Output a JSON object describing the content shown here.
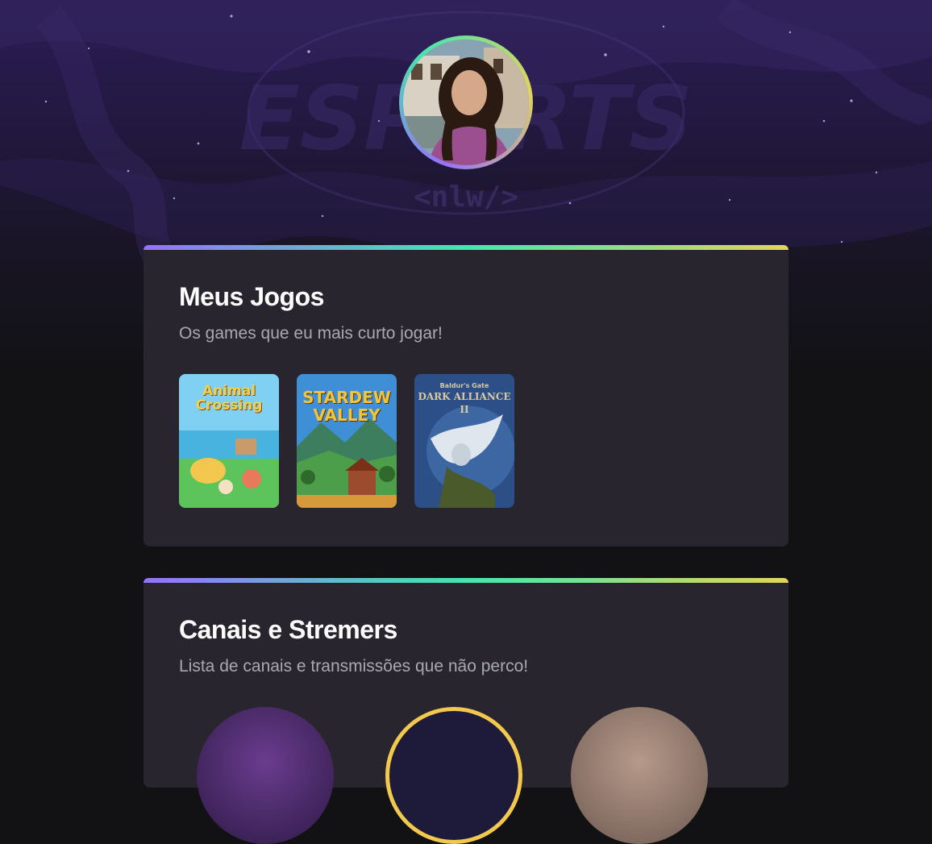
{
  "profile": {
    "avatar_icon": "profile-photo"
  },
  "background": {
    "watermark_text": "ESPORTS",
    "watermark_sub": "<nlw/>"
  },
  "games_section": {
    "title": "Meus Jogos",
    "subtitle": "Os games que eu mais curto jogar!",
    "games": [
      {
        "name": "Animal Crossing",
        "cover_line1": "Animal",
        "cover_line2": "Crossing"
      },
      {
        "name": "Stardew Valley",
        "cover_line1": "STARDEW",
        "cover_line2": "VALLEY"
      },
      {
        "name": "Dark Alliance II",
        "cover_line1": "Baldur's Gate",
        "cover_line2": "DARK ALLIANCE II"
      }
    ]
  },
  "channels_section": {
    "title": "Canais e Stremers",
    "subtitle": "Lista de canais e transmissões que não perco!"
  },
  "colors": {
    "accent_purple": "#9572FC",
    "accent_green": "#43E7AD",
    "accent_yellow": "#E2D45C",
    "card_bg": "#29252f",
    "page_bg": "#121214"
  }
}
